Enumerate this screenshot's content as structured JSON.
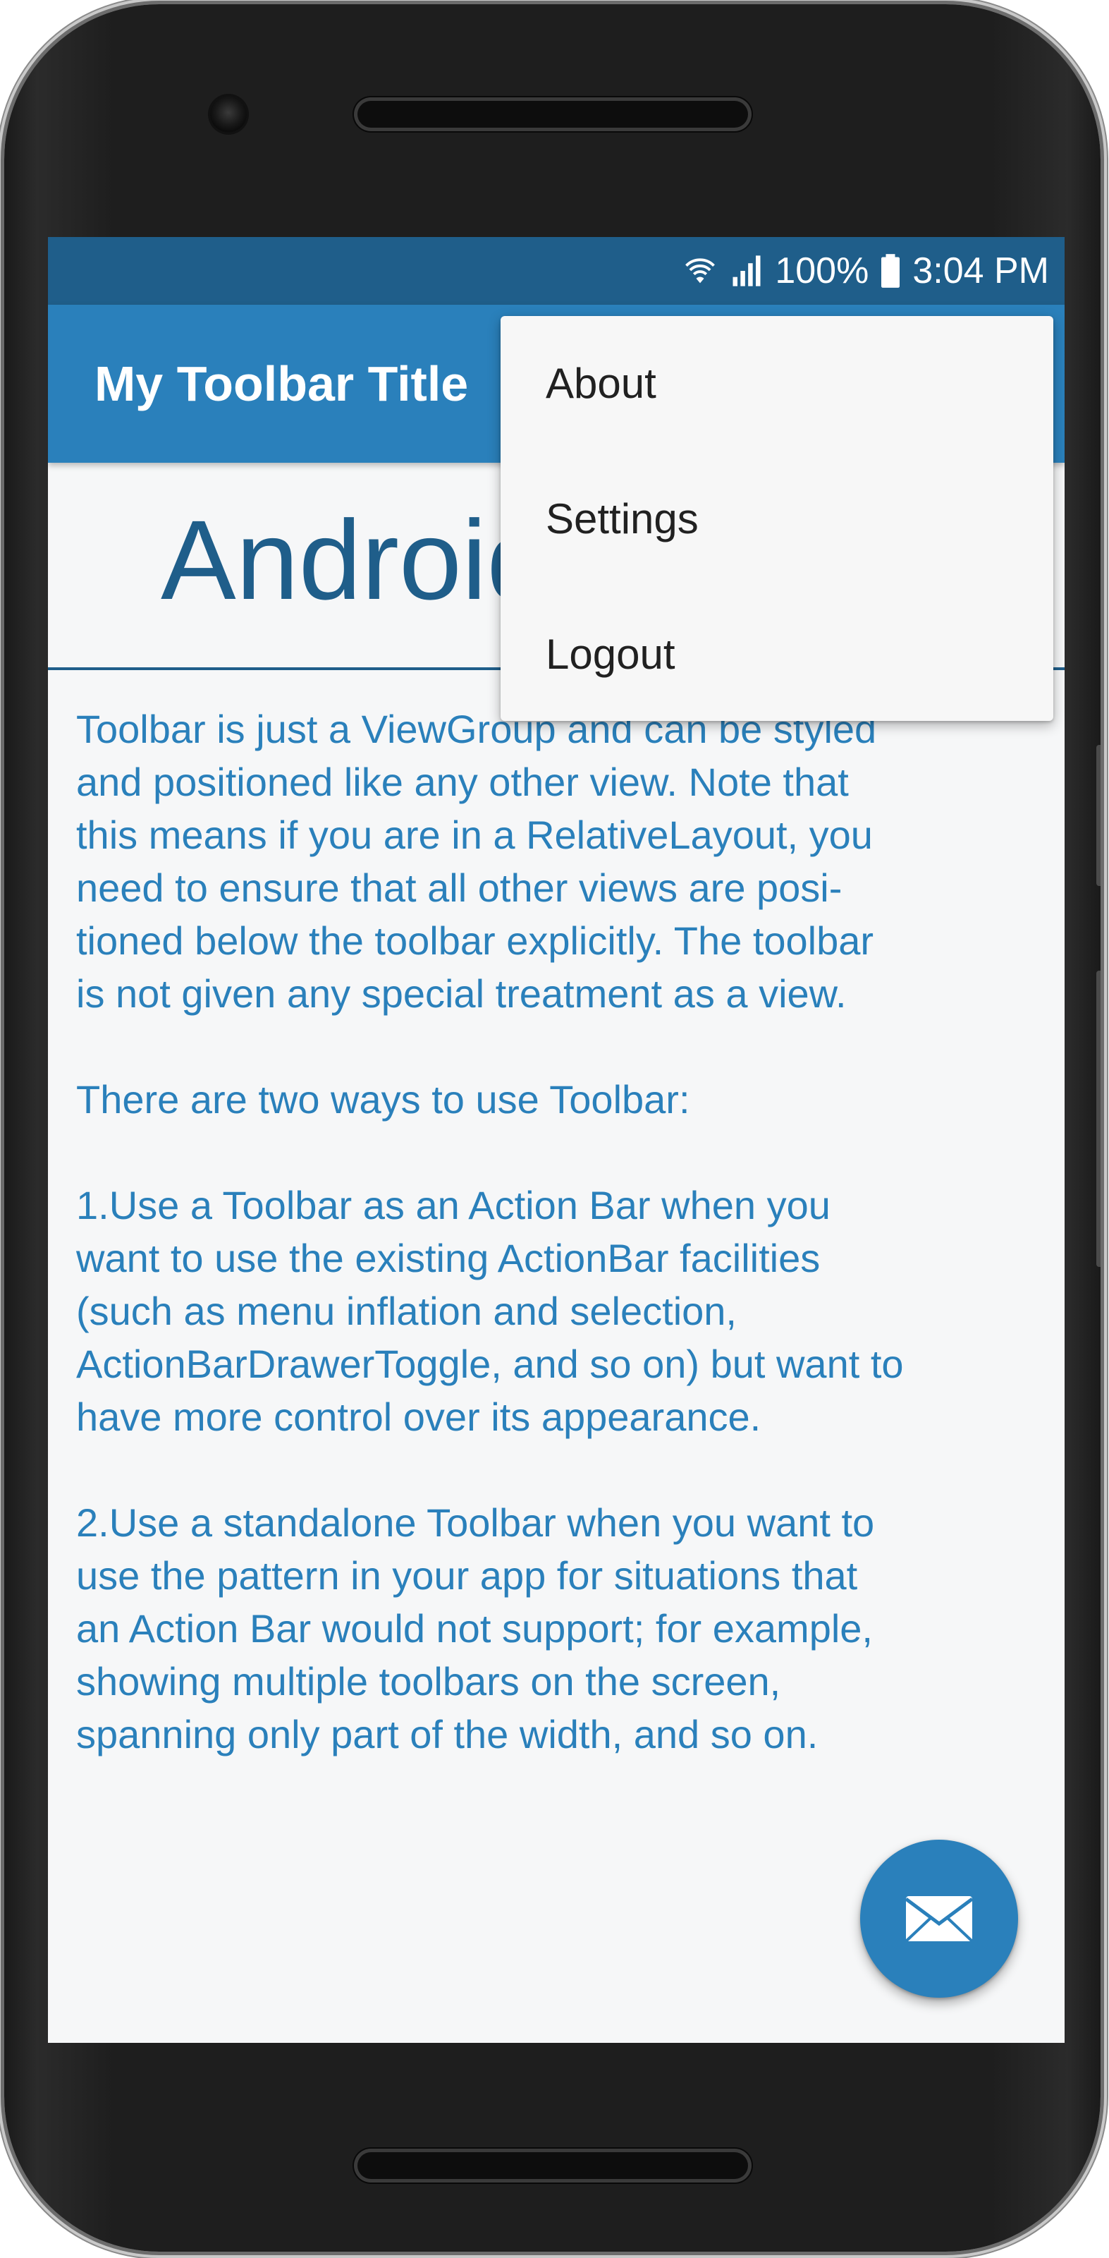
{
  "status_bar": {
    "battery_percent": "100%",
    "time": "3:04 PM",
    "icons": [
      "wifi-icon",
      "signal-icon",
      "battery-icon"
    ]
  },
  "toolbar": {
    "title": "My Toolbar Title"
  },
  "overflow_menu": {
    "items": [
      {
        "label": "About"
      },
      {
        "label": "Settings"
      },
      {
        "label": "Logout"
      }
    ]
  },
  "content": {
    "heading": "Android",
    "paragraphs": [
      "Toolbar is just a ViewGroup and can be styled\nand positioned like any other view. Note that\nthis means if you are in a RelativeLayout, you\nneed to ensure that all other views are posi-\ntioned below the toolbar explicitly. The toolbar\nis not given any special treatment as a view.",
      "There are two ways to use Toolbar:",
      "1.Use a Toolbar as an Action Bar when you\nwant to use the existing ActionBar facilities\n(such as menu inflation and selection,\nActionBarDrawerToggle, and so on) but want to\nhave more control over its appearance.",
      "2.Use a standalone Toolbar when you want to\nuse the pattern in your app for situations that\nan Action Bar would not support; for example,\nshowing multiple toolbars on the screen,\nspanning only part of the width, and so on."
    ]
  },
  "fab": {
    "icon": "mail-icon"
  },
  "colors": {
    "primary": "#2a80bb",
    "primary_dark": "#1f5e8a",
    "background": "#f6f7f8",
    "menu_background": "#f7f7f7"
  }
}
